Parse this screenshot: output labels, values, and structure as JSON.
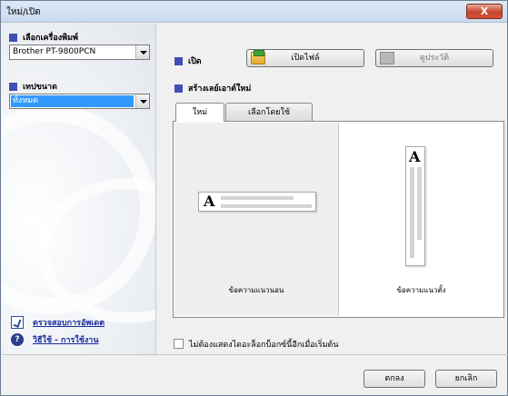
{
  "window": {
    "title": "ใหม่/เปิด",
    "close_label": "X"
  },
  "left": {
    "printer_label": "เลือกเครื่องพิมพ์",
    "printer_value": "Brother PT-9800PCN",
    "tape_label": "เทปขนาด",
    "tape_value": "ทั้งหมด",
    "link_check": "ตรวจสอบการอัพเดต",
    "link_help": "วิธีใช้ - การใช้งาน"
  },
  "main": {
    "open_label": "เปิด",
    "open_file_button": "เปิดไฟล์",
    "history_button": "ดูประวัติ",
    "create_label": "สร้างเลย์เอาต์ใหม่",
    "tabs": [
      {
        "label": "ใหม่"
      },
      {
        "label": "เลือกโดยใช้"
      }
    ],
    "layouts": {
      "horizontal_caption": "ข้อความแนวนอน",
      "vertical_caption": "ข้อความแนวตั้ง",
      "preview_letter": "A"
    },
    "dont_show_label": "ไม่ต้องแสดงไดอะล็อกบ็อกซ์นี้อีกเมื่อเริ่มต้น"
  },
  "footer": {
    "ok": "ตกลง",
    "cancel": "ยกเลิก"
  },
  "colors": {
    "accent": "#3f4fb5",
    "selection": "#3399ff",
    "link": "#1a2d9b"
  },
  "icons": {
    "open_file": "folder-open-icon",
    "history": "history-icon",
    "check_update": "update-check-icon",
    "help": "help-icon"
  }
}
